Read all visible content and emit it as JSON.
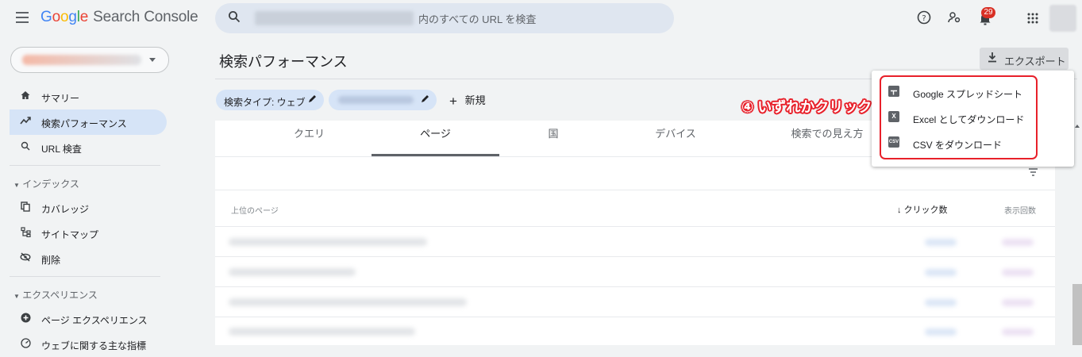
{
  "app": {
    "brand_letters": [
      "G",
      "o",
      "o",
      "g",
      "l",
      "e"
    ],
    "product": "Search Console"
  },
  "search": {
    "placeholder_suffix": "内のすべての URL を検査"
  },
  "topbar": {
    "help_icon": "help-circle-icon",
    "people_icon": "manage-users-icon",
    "notifications_count": "29",
    "apps_icon": "apps-grid-icon"
  },
  "sidebar": {
    "items": [
      {
        "label": "サマリー",
        "icon": "home-icon"
      },
      {
        "label": "検索パフォーマンス",
        "icon": "trending-icon",
        "active": true
      },
      {
        "label": "URL 検査",
        "icon": "search-icon"
      }
    ],
    "index_section": {
      "title": "インデックス",
      "items": [
        {
          "label": "カバレッジ",
          "icon": "copy-icon"
        },
        {
          "label": "サイトマップ",
          "icon": "sitemap-icon"
        },
        {
          "label": "削除",
          "icon": "visibility-off-icon"
        }
      ]
    },
    "experience_section": {
      "title": "エクスペリエンス",
      "items": [
        {
          "label": "ページ エクスペリエンス",
          "icon": "plus-circle-icon"
        },
        {
          "label": "ウェブに関する主な指標",
          "icon": "gauge-icon"
        }
      ]
    }
  },
  "main": {
    "title": "検索パフォーマンス",
    "export_label": "エクスポート",
    "filters": {
      "search_type": "検索タイプ: ウェブ",
      "new_label": "新規"
    },
    "tabs": [
      "クエリ",
      "ページ",
      "国",
      "デバイス",
      "検索での見え方"
    ],
    "active_tab": "ページ",
    "table": {
      "col_page": "上位のページ",
      "col_clicks": "クリック数",
      "col_impressions": "表示回数"
    }
  },
  "export_menu": {
    "items": [
      {
        "label": "Google スプレッドシート",
        "icon": "sheets-icon"
      },
      {
        "label": "Excel としてダウンロード",
        "icon": "excel-icon"
      },
      {
        "label": "CSV をダウンロード",
        "icon": "csv-icon"
      }
    ]
  },
  "annotation": {
    "text": "④ いずれかクリック"
  },
  "colors": {
    "accent_active": "#d6e4f7",
    "annotation_red": "#e8202a",
    "badge_red": "#d93025"
  }
}
